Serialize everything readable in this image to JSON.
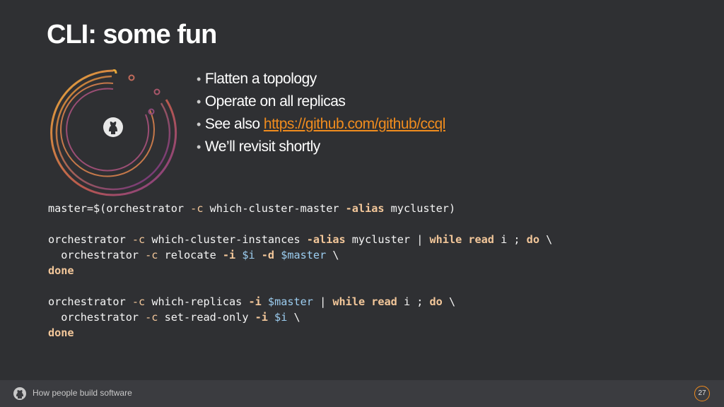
{
  "slide": {
    "title": "CLI: some fun"
  },
  "bullets": {
    "items": [
      "Flatten a topology",
      "Operate on all replicas",
      "See also",
      "We’ll revisit shortly"
    ],
    "link_text": "https://github.com/github/ccql"
  },
  "code": {
    "line1_cmd": "master=$(orchestrator ",
    "line1_c": "-c",
    "line1_sub": " which-cluster-master ",
    "line1_alias": "-alias",
    "line1_rest": " mycluster)",
    "line3_cmd": "orchestrator ",
    "line3_c": "-c",
    "line3_sub": " which-cluster-instances ",
    "line3_alias": "-alias",
    "line3_mid": " mycluster | ",
    "line3_while": "while read",
    "line3_i": " i ; ",
    "line3_do": "do",
    "line3_end": " \\",
    "line4_cmd": "  orchestrator ",
    "line4_c": "-c",
    "line4_sub": " relocate ",
    "line4_i": "-i",
    "line4_var": " $i ",
    "line4_d": "-d",
    "line4_master": " $master",
    "line4_end": " \\",
    "line5_done": "done",
    "line7_cmd": "orchestrator ",
    "line7_c": "-c",
    "line7_sub": " which-replicas ",
    "line7_i": "-i",
    "line7_master": " $master",
    "line7_mid": " | ",
    "line7_while": "while read",
    "line7_i2": " i ; ",
    "line7_do": "do",
    "line7_end": " \\",
    "line8_cmd": "  orchestrator ",
    "line8_c": "-c",
    "line8_sub": " set-read-only ",
    "line8_i": "-i",
    "line8_var": " $i",
    "line8_end": " \\",
    "line9_done": "done"
  },
  "footer": {
    "tagline": "How people build software",
    "page_number": "27"
  },
  "colors": {
    "background": "#2f3033",
    "link": "#f08c1e",
    "keyword": "#f3c79a",
    "variable": "#9ccdf0"
  },
  "icons": [
    "github-octocat-icon",
    "orbit-logo-art",
    "bullet-dot-icon"
  ]
}
